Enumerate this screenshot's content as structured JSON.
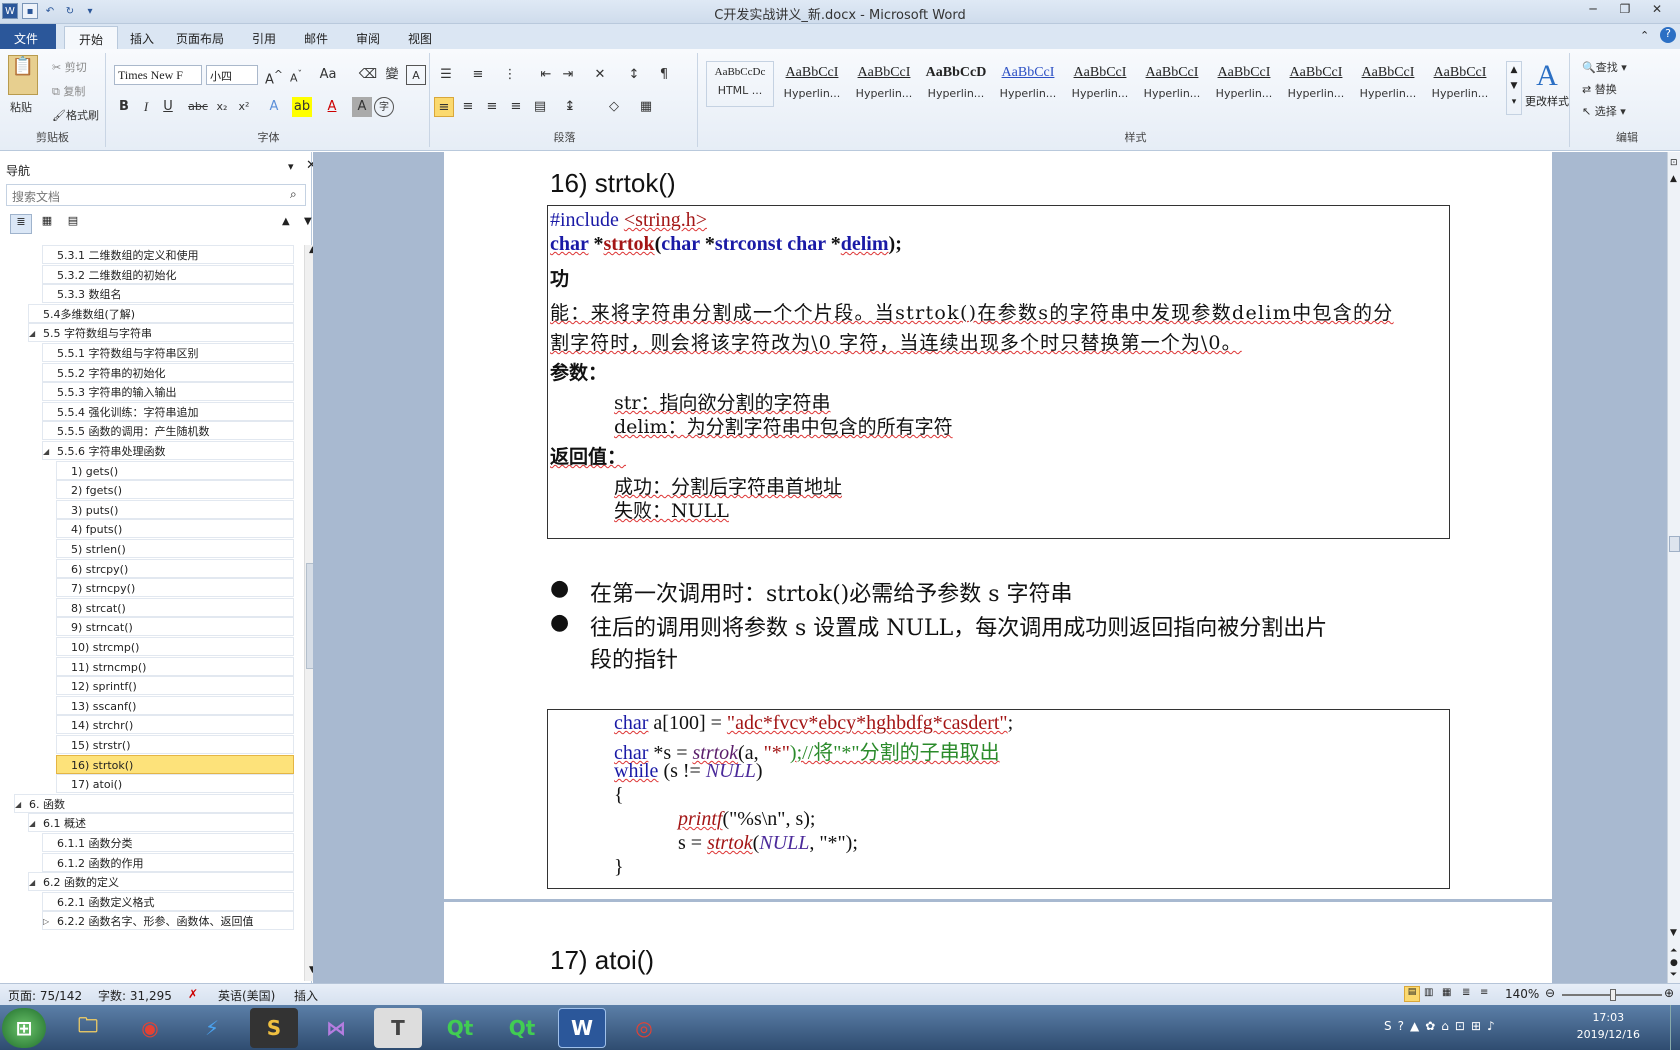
{
  "window": {
    "title": "C开发实战讲义_新.docx - Microsoft Word"
  },
  "tabs": [
    "文件",
    "开始",
    "插入",
    "页面布局",
    "引用",
    "邮件",
    "审阅",
    "视图"
  ],
  "ribbon": {
    "clipboard": {
      "label": "剪贴板",
      "paste": "粘贴",
      "cut": "剪切",
      "copy": "复制",
      "format_painter": "格式刷"
    },
    "font": {
      "label": "字体",
      "name": "Times New F",
      "size": "小四"
    },
    "paragraph": {
      "label": "段落"
    },
    "styles": {
      "label": "样式",
      "items": [
        {
          "preview": "AaBbCcDc",
          "name": "HTML ..."
        },
        {
          "preview": "AaBbCcI",
          "name": "Hyperlin..."
        },
        {
          "preview": "AaBbCcI",
          "name": "Hyperlin..."
        },
        {
          "preview": "AaBbCcD",
          "name": "Hyperlin..."
        },
        {
          "preview": "AaBbCcI",
          "name": "Hyperlin..."
        },
        {
          "preview": "AaBbCcI",
          "name": "Hyperlin..."
        },
        {
          "preview": "AaBbCcI",
          "name": "Hyperlin..."
        },
        {
          "preview": "AaBbCcI",
          "name": "Hyperlin..."
        },
        {
          "preview": "AaBbCcI",
          "name": "Hyperlin..."
        },
        {
          "preview": "AaBbCcI",
          "name": "Hyperlin..."
        },
        {
          "preview": "AaBbCcI",
          "name": "Hyperlin..."
        }
      ],
      "change_styles": "更改样式"
    },
    "editing": {
      "label": "编辑",
      "find": "查找",
      "replace": "替换",
      "select": "选择"
    }
  },
  "nav": {
    "title": "导航",
    "search_placeholder": "搜索文档",
    "items": [
      {
        "text": "5.3.1 二维数组的定义和使用",
        "level": 3
      },
      {
        "text": "5.3.2 二维数组的初始化",
        "level": 3
      },
      {
        "text": "5.3.3 数组名",
        "level": 3
      },
      {
        "text": "5.4多维数组(了解)",
        "level": 2
      },
      {
        "text": "5.5 字符数组与字符串",
        "level": 2,
        "expanded": true
      },
      {
        "text": "5.5.1 字符数组与字符串区别",
        "level": 3
      },
      {
        "text": "5.5.2 字符串的初始化",
        "level": 3
      },
      {
        "text": "5.5.3 字符串的输入输出",
        "level": 3
      },
      {
        "text": "5.5.4 强化训练：字符串追加",
        "level": 3
      },
      {
        "text": "5.5.5 函数的调用：产生随机数",
        "level": 3
      },
      {
        "text": "5.5.6 字符串处理函数",
        "level": 3,
        "expanded": true
      },
      {
        "text": "1) gets()",
        "level": 4
      },
      {
        "text": "2) fgets()",
        "level": 4
      },
      {
        "text": "3) puts()",
        "level": 4
      },
      {
        "text": "4) fputs()",
        "level": 4
      },
      {
        "text": "5) strlen()",
        "level": 4
      },
      {
        "text": "6) strcpy()",
        "level": 4
      },
      {
        "text": "7) strncpy()",
        "level": 4
      },
      {
        "text": "8) strcat()",
        "level": 4
      },
      {
        "text": "9) strncat()",
        "level": 4
      },
      {
        "text": "10) strcmp()",
        "level": 4
      },
      {
        "text": "11) strncmp()",
        "level": 4
      },
      {
        "text": "12) sprintf()",
        "level": 4
      },
      {
        "text": "13) sscanf()",
        "level": 4
      },
      {
        "text": "14) strchr()",
        "level": 4
      },
      {
        "text": "15) strstr()",
        "level": 4
      },
      {
        "text": "16) strtok()",
        "level": 4,
        "selected": true
      },
      {
        "text": "17) atoi()",
        "level": 4
      },
      {
        "text": "6. 函数",
        "level": 1,
        "expanded": true
      },
      {
        "text": "6.1 概述",
        "level": 2,
        "expanded": true
      },
      {
        "text": "6.1.1 函数分类",
        "level": 3
      },
      {
        "text": "6.1.2 函数的作用",
        "level": 3
      },
      {
        "text": "6.2 函数的定义",
        "level": 2,
        "expanded": true
      },
      {
        "text": "6.2.1 函数定义格式",
        "level": 3
      },
      {
        "text": "6.2.2 函数名字、形参、函数体、返回值",
        "level": 3,
        "collapsed": true
      }
    ]
  },
  "doc": {
    "heading1": "16) strtok()",
    "proto": {
      "include": "#include ",
      "header": "<string.h>",
      "l2a": "char",
      "l2b": " *",
      "l2c": "strtok",
      "l2d": "(",
      "l2e": "char",
      "l2f": " *",
      "l2g": "str",
      ", ": ", ",
      "l2h": "const char",
      "l2i": " *",
      "l2j": "delim",
      ");": ");"
    },
    "func_label": "功",
    "func_line1": "能：来将字符串分割成一个个片段。当strtok()在参数s的字符串中发现参数delim中包含的分",
    "func_line2": "割字符时，则会将该字符改为\\0 字符，当连续出现多个时只替换第一个为\\0。",
    "params_label": "参数：",
    "param1": "str：指向欲分割的字符串",
    "param2": "delim：为分割字符串中包含的所有字符",
    "ret_label": "返回值：",
    "ret1": "成功：分割后字符串首地址",
    "ret2": "失败：NULL",
    "bullet1": "在第一次调用时：strtok()必需给予参数 s 字符串",
    "bullet2a": "往后的调用则将参数 s 设置成 NULL，每次调用成功则返回指向被分割出片",
    "bullet2b": "段的指针",
    "code": {
      "c1a": "char",
      " a[100] = ": " a[100] = ",
      "c1b": "\"adc*fvcv*ebcy*hghbdfg*casdert\"",
      ";": ";",
      "c2a": "char",
      " *s = ": " *s = ",
      "c2b": "strtok",
      "c2c": "(a, ",
      "c2d": "\"*\"",
      "c2e": ");//将\"*\"分割的子串取出",
      "c3a": "while",
      "c3b": " (s != ",
      "c3c": "NULL",
      ")": ")",
      "c4": "{",
      "c5a": "printf",
      "c5b": "(\"%s\\n\", s);",
      "c6a": "s = ",
      "c6b": "strtok",
      "c6c": "(",
      "c6d": "NULL",
      ", \"*\");": ", \"*\");",
      "c7": "}"
    },
    "heading2": "17) atoi()"
  },
  "status": {
    "page": "页面: 75/142",
    "words": "字数: 31,295",
    "lang": "英语(美国)",
    "mode": "插入",
    "zoom": "140%"
  },
  "clock": {
    "time": "17:03",
    "date": "2019/12/16"
  },
  "colors": {
    "file_tab": "#2b579a",
    "selected_nav": "#fde27a",
    "keyword": "#1a1aa6",
    "string": "#a31515",
    "comment": "#2a8a2a"
  }
}
